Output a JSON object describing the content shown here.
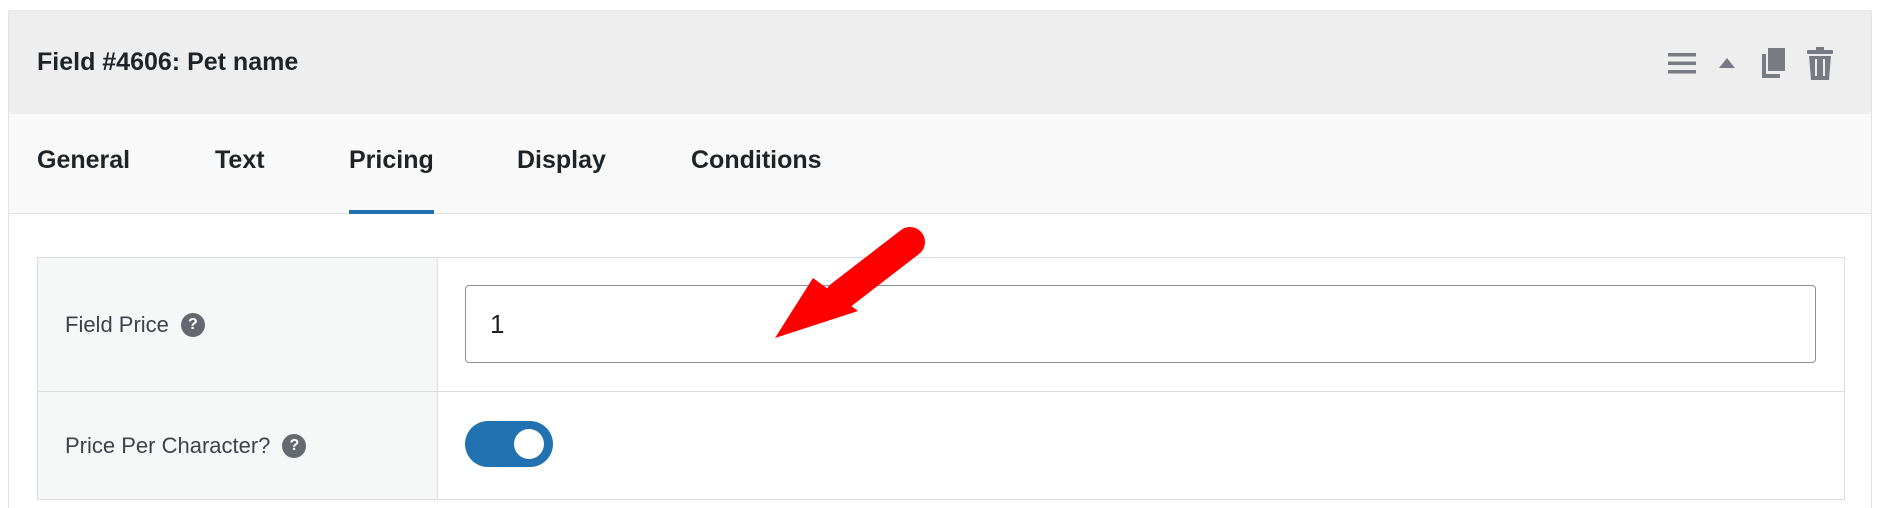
{
  "header": {
    "title": "Field #4606: Pet name",
    "actions": [
      {
        "icon": "menu-icon"
      },
      {
        "icon": "collapse-up-icon"
      },
      {
        "icon": "duplicate-icon"
      },
      {
        "icon": "trash-icon"
      }
    ]
  },
  "tabs": [
    {
      "label": "General",
      "active": false
    },
    {
      "label": "Text",
      "active": false
    },
    {
      "label": "Pricing",
      "active": true
    },
    {
      "label": "Display",
      "active": false
    },
    {
      "label": "Conditions",
      "active": false
    }
  ],
  "fields": {
    "field_price": {
      "label": "Field Price",
      "value": "1",
      "help_icon": "question-icon"
    },
    "price_per_character": {
      "label": "Price Per Character?",
      "enabled": true,
      "help_icon": "question-icon"
    }
  },
  "help_glyph": "?",
  "colors": {
    "accent": "#2271b1",
    "header_bg": "#eeeeee",
    "annotation_arrow": "#ff0000"
  }
}
